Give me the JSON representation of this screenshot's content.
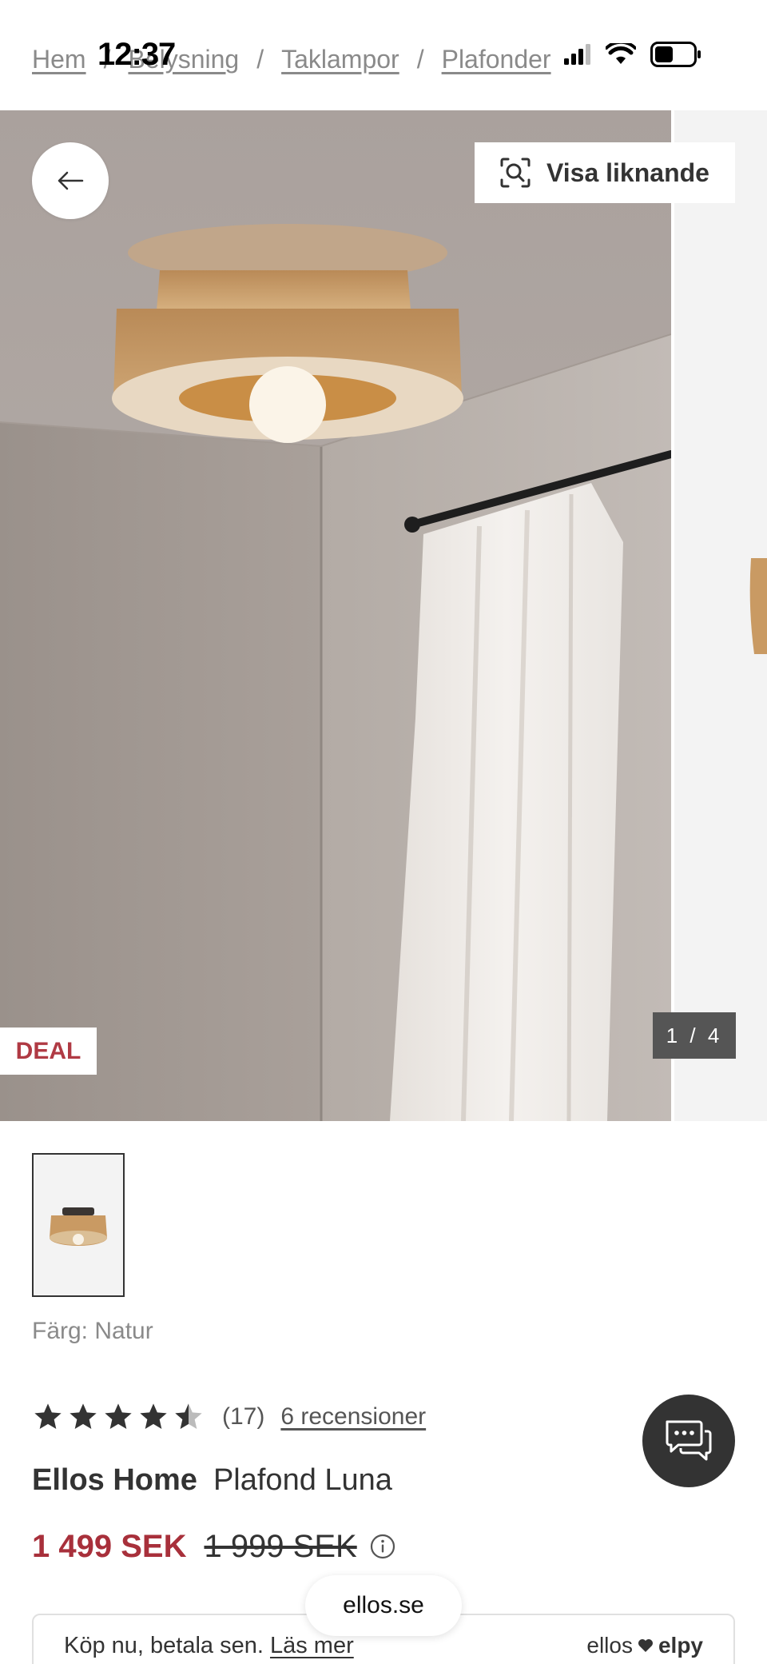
{
  "status_bar": {
    "time": "12:37"
  },
  "breadcrumb": {
    "items": [
      "Hem",
      "Belysning",
      "Taklampor",
      "Plafonder"
    ],
    "separator": "/"
  },
  "gallery": {
    "similar_label": "Visa liknande",
    "badge": "DEAL",
    "counter": "1 / 4"
  },
  "product": {
    "color_label": "Färg: Natur",
    "rating_value": 4.5,
    "rating_count": "(17)",
    "reviews_link": "6 recensioner",
    "brand": "Ellos Home",
    "name": "Plafond Luna",
    "price_now": "1 499 SEK",
    "price_was": "1 999 SEK"
  },
  "payment": {
    "text": "Köp nu, betala sen.",
    "link": "Läs mer",
    "logo_left": "ellos",
    "logo_right": "elpy"
  },
  "browser": {
    "url": "ellos.se"
  },
  "colors": {
    "accent_red": "#a8303b",
    "badge_red": "#b03a44",
    "text_dark": "#333333"
  }
}
